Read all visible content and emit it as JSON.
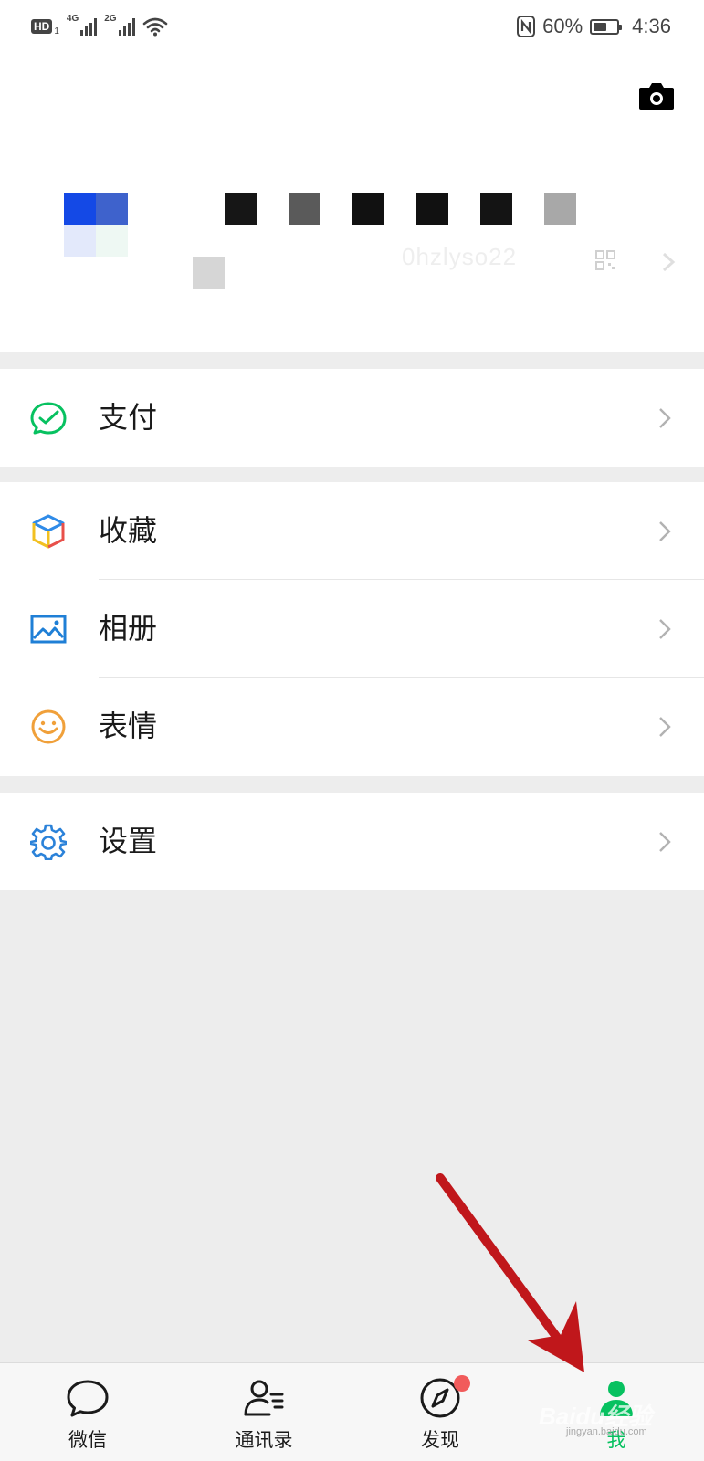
{
  "status_bar": {
    "hd_label": "HD",
    "sim1": "1",
    "net1": "4G",
    "net2": "2G",
    "battery_text": "60%",
    "battery_level": 0.6,
    "time": "4:36",
    "nfc_icon": "nfc-icon",
    "wifi_icon": "wifi-icon"
  },
  "profile": {
    "camera_icon": "camera-icon",
    "wechat_id_fragment": "0hzlyso22",
    "qr_icon": "qr-code-icon"
  },
  "menu": {
    "pay": {
      "label": "支付",
      "icon": "wallet-check-icon",
      "color": "#07c160"
    },
    "favorites": {
      "label": "收藏",
      "icon": "cube-icon"
    },
    "album": {
      "label": "相册",
      "icon": "image-icon",
      "color": "#1f7fd6"
    },
    "stickers": {
      "label": "表情",
      "icon": "smiley-icon",
      "color": "#f0a03a"
    },
    "settings": {
      "label": "设置",
      "icon": "gear-icon",
      "color": "#2b82d9"
    }
  },
  "tabbar": {
    "chats": {
      "label": "微信",
      "icon": "chat-bubble-icon"
    },
    "contacts": {
      "label": "通讯录",
      "icon": "contacts-icon"
    },
    "discover": {
      "label": "发现",
      "icon": "compass-icon",
      "badge": "red-dot"
    },
    "me": {
      "label": "我",
      "icon": "person-icon",
      "active": true,
      "color": "#07c160"
    }
  },
  "annotation": {
    "arrow_color": "#c0171b"
  },
  "watermark": {
    "brand": "Baidu经验",
    "url": "jingyan.baidu.com"
  }
}
